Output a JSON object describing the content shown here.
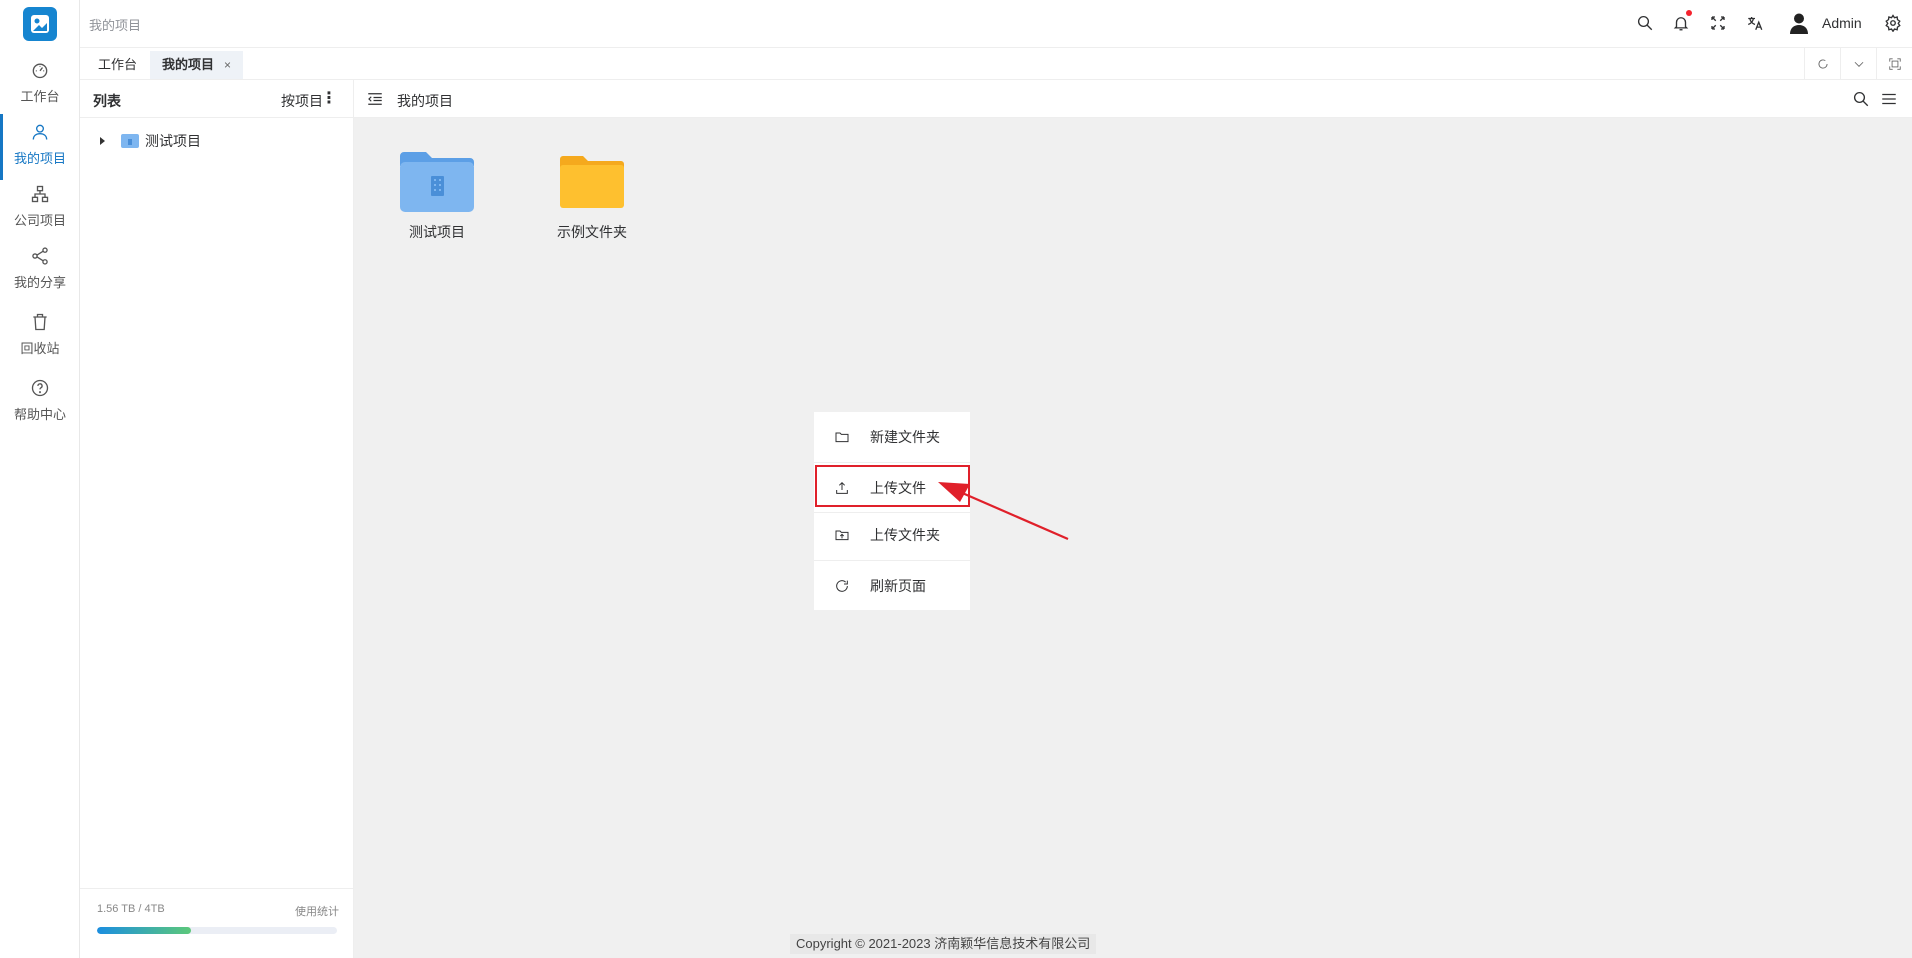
{
  "nav": {
    "items": [
      {
        "label": "工作台",
        "icon": "dashboard-icon"
      },
      {
        "label": "我的项目",
        "icon": "user-icon"
      },
      {
        "label": "公司项目",
        "icon": "org-chart-icon"
      },
      {
        "label": "我的分享",
        "icon": "share-icon"
      },
      {
        "label": "回收站",
        "icon": "trash-icon"
      },
      {
        "label": "帮助中心",
        "icon": "help-icon"
      }
    ],
    "active_index": 1
  },
  "header": {
    "breadcrumb": "我的项目",
    "user_name": "Admin",
    "icons": [
      "search-icon",
      "bell-icon",
      "fullscreen-icon",
      "translate-icon",
      "avatar",
      "gear-icon"
    ]
  },
  "tabs": [
    {
      "label": "工作台"
    },
    {
      "label": "我的项目",
      "close": "×"
    }
  ],
  "panel": {
    "title": "列表",
    "sort_label": "按项目",
    "more": "⋮",
    "tree": [
      {
        "label": "测试项目"
      }
    ],
    "storage": {
      "text": "1.56 TB / 4TB",
      "link": "使用统计",
      "used_fraction": 0.39
    }
  },
  "main": {
    "title": "我的项目",
    "files": [
      {
        "name": "测试项目",
        "type": "project-folder"
      },
      {
        "name": "示例文件夹",
        "type": "folder"
      }
    ]
  },
  "context_menu": {
    "items": [
      {
        "label": "新建文件夹",
        "icon": "folder-icon"
      },
      {
        "label": "上传文件",
        "icon": "upload-icon"
      },
      {
        "label": "上传文件夹",
        "icon": "upload-folder-icon"
      },
      {
        "label": "刷新页面",
        "icon": "refresh-icon"
      }
    ]
  },
  "footer": {
    "copyright": "Copyright © 2021-2023 济南颖华信息技术有限公司"
  },
  "colors": {
    "accent": "#1677c4",
    "highlight": "#e0202a",
    "folder_blue": "#7eb6f0",
    "folder_yellow": "#fec02f"
  }
}
